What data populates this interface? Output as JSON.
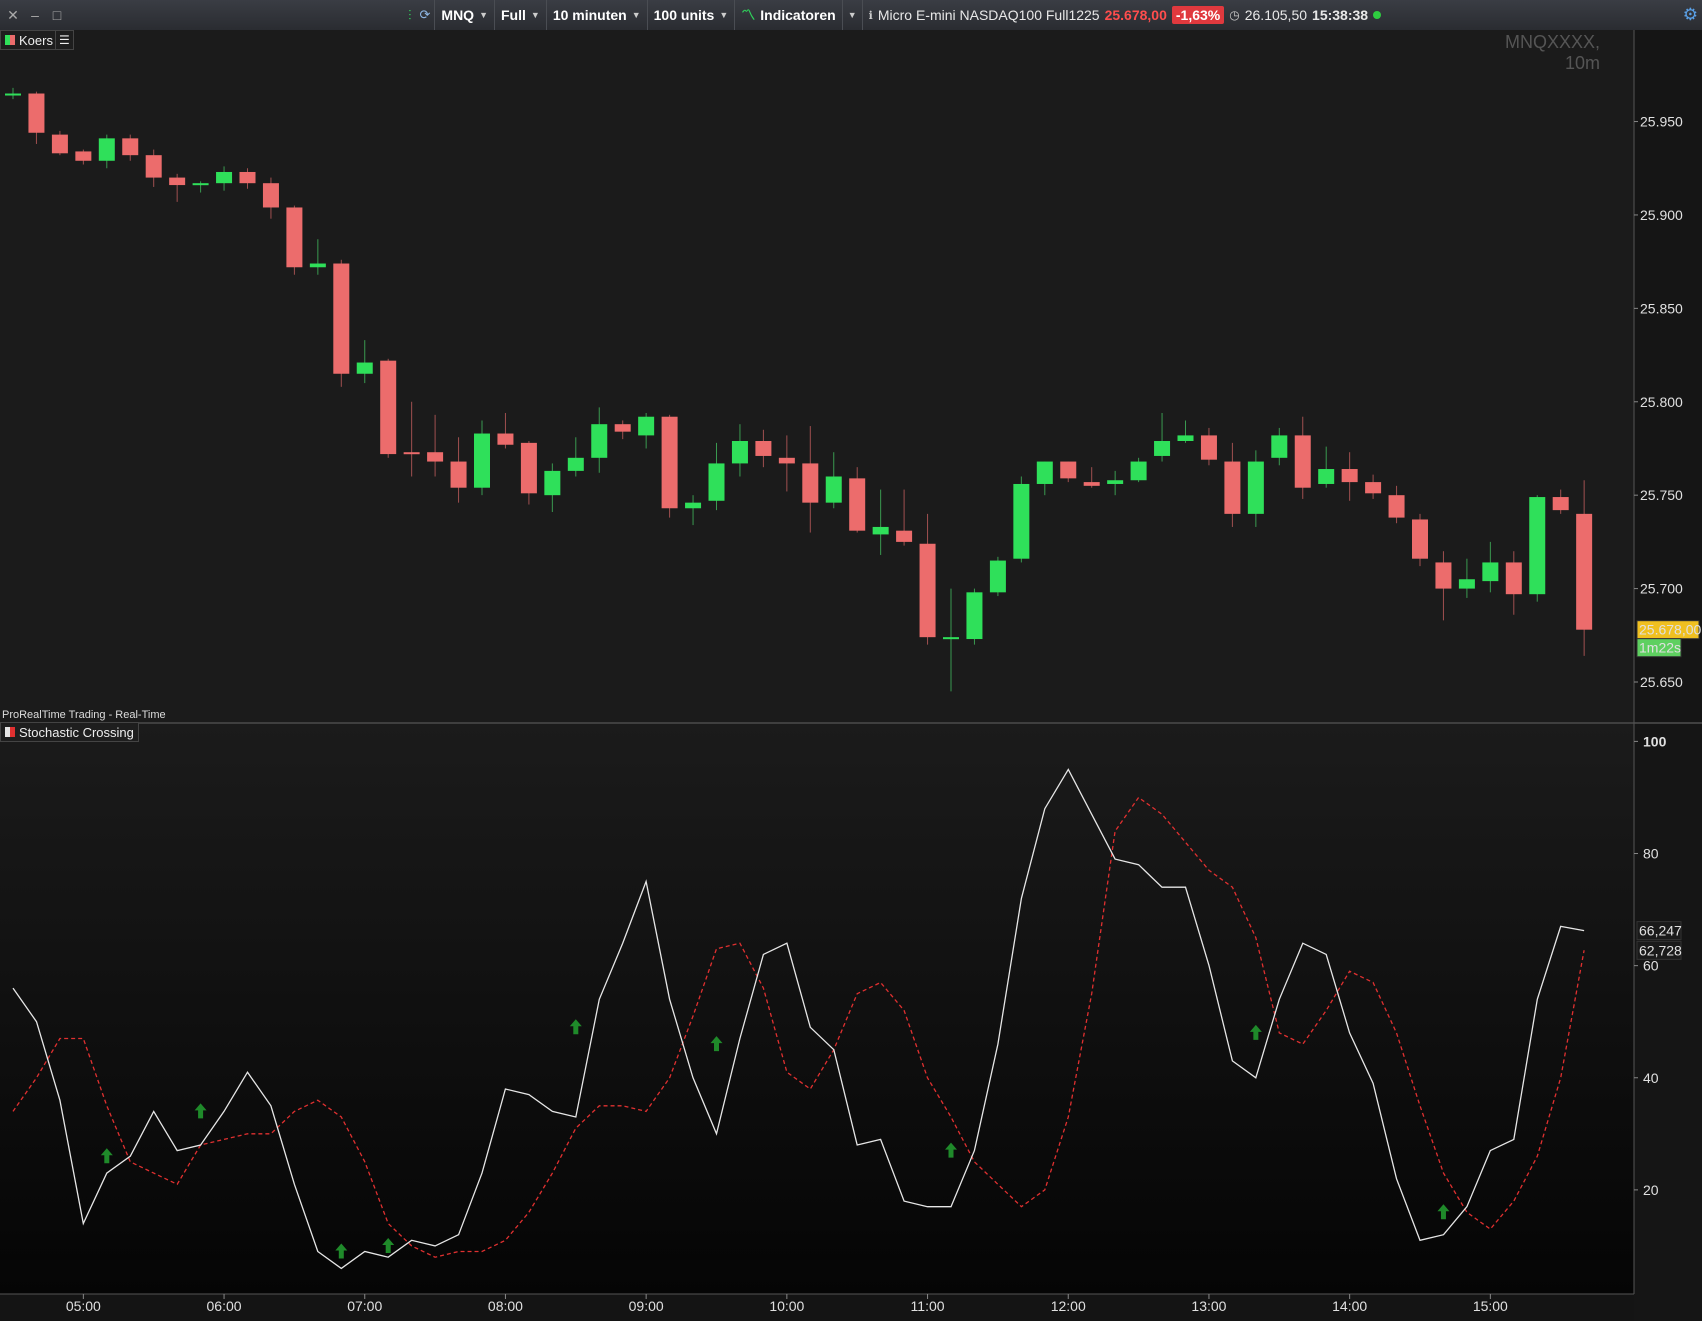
{
  "toolbar": {
    "symbol": "MNQ",
    "mode": "Full",
    "interval": "10 minuten",
    "units": "100 units",
    "indicators": "Indicatoren",
    "instrument": "Micro E-mini NASDAQ100 Full1225",
    "last_price": "25.678,00",
    "change_pct": "-1,63%",
    "prev_value": "26.105,50",
    "clock": "15:38:38"
  },
  "price_pane": {
    "label": "Koers",
    "watermark": "MNQXXXX, 10m",
    "source": "ProRealTime Trading - Real-Time",
    "last_price_tag": "25.678,00",
    "countdown_tag": "1m22s"
  },
  "osc_pane": {
    "label": "Stochastic Crossing",
    "k_value_tag": "66,247",
    "d_value_tag": "62,728"
  },
  "colors": {
    "up": "#2fe05a",
    "down": "#ec6c6c",
    "k_line": "#e6e6e6",
    "d_line": "#e03030",
    "arrow": "#1f8a2a",
    "price_tag": "#f0c020",
    "countdown_tag": "#5ed060"
  },
  "icons": [
    "close-icon",
    "minimize-icon",
    "maximize-icon",
    "bar-chart-icon",
    "sync-icon",
    "chevron-down-icon",
    "indicator-chart-icon",
    "info-icon",
    "clock-icon",
    "settings-gear-icon",
    "list-icon"
  ],
  "chart_data": [
    {
      "type": "candlestick",
      "ylim": [
        25630,
        25985
      ],
      "yticks": [
        "25.650",
        "25.700",
        "25.750",
        "25.800",
        "25.850",
        "25.900",
        "25.950"
      ],
      "ytick_values": [
        25650,
        25700,
        25750,
        25800,
        25850,
        25900,
        25950
      ],
      "xticks": [
        "05:00",
        "06:00",
        "07:00",
        "08:00",
        "09:00",
        "10:00",
        "11:00",
        "12:00",
        "13:00",
        "14:00",
        "15:00"
      ],
      "first_bar_time": "04:30",
      "bar_minutes": 10,
      "candles": [
        {
          "o": 25965,
          "h": 25968,
          "l": 25962,
          "c": 25965
        },
        {
          "o": 25965,
          "h": 25966,
          "l": 25938,
          "c": 25944
        },
        {
          "o": 25943,
          "h": 25945,
          "l": 25932,
          "c": 25933
        },
        {
          "o": 25934,
          "h": 25935,
          "l": 25927,
          "c": 25929
        },
        {
          "o": 25929,
          "h": 25943,
          "l": 25925,
          "c": 25941
        },
        {
          "o": 25941,
          "h": 25943,
          "l": 25929,
          "c": 25932
        },
        {
          "o": 25932,
          "h": 25935,
          "l": 25915,
          "c": 25920
        },
        {
          "o": 25920,
          "h": 25922,
          "l": 25907,
          "c": 25916
        },
        {
          "o": 25916,
          "h": 25918,
          "l": 25912,
          "c": 25917
        },
        {
          "o": 25917,
          "h": 25926,
          "l": 25913,
          "c": 25923
        },
        {
          "o": 25923,
          "h": 25925,
          "l": 25914,
          "c": 25917
        },
        {
          "o": 25917,
          "h": 25920,
          "l": 25898,
          "c": 25904
        },
        {
          "o": 25904,
          "h": 25905,
          "l": 25868,
          "c": 25872
        },
        {
          "o": 25872,
          "h": 25887,
          "l": 25868,
          "c": 25874
        },
        {
          "o": 25874,
          "h": 25876,
          "l": 25808,
          "c": 25815
        },
        {
          "o": 25815,
          "h": 25833,
          "l": 25810,
          "c": 25821
        },
        {
          "o": 25822,
          "h": 25823,
          "l": 25770,
          "c": 25772
        },
        {
          "o": 25773,
          "h": 25800,
          "l": 25760,
          "c": 25772
        },
        {
          "o": 25773,
          "h": 25793,
          "l": 25760,
          "c": 25768
        },
        {
          "o": 25768,
          "h": 25781,
          "l": 25746,
          "c": 25754
        },
        {
          "o": 25754,
          "h": 25790,
          "l": 25750,
          "c": 25783
        },
        {
          "o": 25783,
          "h": 25794,
          "l": 25775,
          "c": 25777
        },
        {
          "o": 25778,
          "h": 25779,
          "l": 25745,
          "c": 25751
        },
        {
          "o": 25750,
          "h": 25767,
          "l": 25741,
          "c": 25763
        },
        {
          "o": 25763,
          "h": 25781,
          "l": 25760,
          "c": 25770
        },
        {
          "o": 25770,
          "h": 25797,
          "l": 25762,
          "c": 25788
        },
        {
          "o": 25788,
          "h": 25790,
          "l": 25780,
          "c": 25784
        },
        {
          "o": 25782,
          "h": 25794,
          "l": 25775,
          "c": 25792
        },
        {
          "o": 25792,
          "h": 25793,
          "l": 25738,
          "c": 25743
        },
        {
          "o": 25743,
          "h": 25750,
          "l": 25734,
          "c": 25746
        },
        {
          "o": 25747,
          "h": 25778,
          "l": 25742,
          "c": 25767
        },
        {
          "o": 25767,
          "h": 25788,
          "l": 25760,
          "c": 25779
        },
        {
          "o": 25779,
          "h": 25785,
          "l": 25765,
          "c": 25771
        },
        {
          "o": 25770,
          "h": 25782,
          "l": 25752,
          "c": 25767
        },
        {
          "o": 25767,
          "h": 25787,
          "l": 25730,
          "c": 25746
        },
        {
          "o": 25746,
          "h": 25773,
          "l": 25743,
          "c": 25760
        },
        {
          "o": 25759,
          "h": 25765,
          "l": 25730,
          "c": 25731
        },
        {
          "o": 25729,
          "h": 25753,
          "l": 25718,
          "c": 25733
        },
        {
          "o": 25731,
          "h": 25753,
          "l": 25723,
          "c": 25725
        },
        {
          "o": 25724,
          "h": 25740,
          "l": 25670,
          "c": 25674
        },
        {
          "o": 25674,
          "h": 25700,
          "l": 25645,
          "c": 25674
        },
        {
          "o": 25673,
          "h": 25700,
          "l": 25670,
          "c": 25698
        },
        {
          "o": 25698,
          "h": 25717,
          "l": 25696,
          "c": 25715
        },
        {
          "o": 25716,
          "h": 25760,
          "l": 25714,
          "c": 25756
        },
        {
          "o": 25756,
          "h": 25768,
          "l": 25750,
          "c": 25768
        },
        {
          "o": 25768,
          "h": 25768,
          "l": 25757,
          "c": 25759
        },
        {
          "o": 25757,
          "h": 25765,
          "l": 25754,
          "c": 25755
        },
        {
          "o": 25756,
          "h": 25763,
          "l": 25750,
          "c": 25758
        },
        {
          "o": 25758,
          "h": 25770,
          "l": 25757,
          "c": 25768
        },
        {
          "o": 25771,
          "h": 25794,
          "l": 25768,
          "c": 25779
        },
        {
          "o": 25779,
          "h": 25790,
          "l": 25778,
          "c": 25782
        },
        {
          "o": 25782,
          "h": 25786,
          "l": 25766,
          "c": 25769
        },
        {
          "o": 25768,
          "h": 25778,
          "l": 25733,
          "c": 25740
        },
        {
          "o": 25740,
          "h": 25774,
          "l": 25733,
          "c": 25768
        },
        {
          "o": 25770,
          "h": 25786,
          "l": 25766,
          "c": 25782
        },
        {
          "o": 25782,
          "h": 25792,
          "l": 25748,
          "c": 25754
        },
        {
          "o": 25756,
          "h": 25776,
          "l": 25754,
          "c": 25764
        },
        {
          "o": 25764,
          "h": 25773,
          "l": 25747,
          "c": 25757
        },
        {
          "o": 25757,
          "h": 25761,
          "l": 25748,
          "c": 25751
        },
        {
          "o": 25750,
          "h": 25755,
          "l": 25735,
          "c": 25738
        },
        {
          "o": 25737,
          "h": 25740,
          "l": 25712,
          "c": 25716
        },
        {
          "o": 25714,
          "h": 25720,
          "l": 25683,
          "c": 25700
        },
        {
          "o": 25700,
          "h": 25716,
          "l": 25695,
          "c": 25705
        },
        {
          "o": 25704,
          "h": 25725,
          "l": 25698,
          "c": 25714
        },
        {
          "o": 25714,
          "h": 25720,
          "l": 25686,
          "c": 25697
        },
        {
          "o": 25697,
          "h": 25750,
          "l": 25693,
          "c": 25749
        },
        {
          "o": 25749,
          "h": 25753,
          "l": 25740,
          "c": 25742
        },
        {
          "o": 25740,
          "h": 25758,
          "l": 25664,
          "c": 25678
        }
      ]
    },
    {
      "type": "line",
      "ylim": [
        0,
        105
      ],
      "yticks": [
        "20",
        "40",
        "60",
        "80",
        "100"
      ],
      "ytick_values": [
        20,
        40,
        60,
        80,
        100
      ],
      "xticks": [
        "05:00",
        "06:00",
        "07:00",
        "08:00",
        "09:00",
        "10:00",
        "11:00",
        "12:00",
        "13:00",
        "14:00",
        "15:00"
      ],
      "series": [
        {
          "values": [
            56,
            50,
            36,
            14,
            23,
            26,
            34,
            27,
            28,
            34,
            41,
            35,
            21,
            9,
            6,
            9,
            8,
            11,
            10,
            12,
            23,
            38,
            37,
            34,
            33,
            54,
            64,
            75,
            54,
            40,
            30,
            47,
            62,
            64,
            49,
            45,
            28,
            29,
            18,
            17,
            17,
            27,
            46,
            72,
            88,
            95,
            87,
            79,
            78,
            74,
            74,
            60,
            43,
            40,
            54,
            64,
            62,
            48,
            39,
            22,
            11,
            12,
            17,
            27,
            29,
            54,
            67,
            66.247
          ]
        },
        {
          "values": [
            34,
            40,
            47,
            47,
            35,
            25,
            23,
            21,
            28,
            29,
            30,
            30,
            34,
            36,
            33,
            25,
            14,
            10,
            8,
            9,
            9,
            11,
            16,
            23,
            31,
            35,
            35,
            34,
            40,
            51,
            63,
            64,
            56,
            41,
            38,
            45,
            55,
            57,
            52,
            40,
            33,
            25,
            21,
            17,
            20,
            33,
            55,
            84,
            90,
            87,
            82,
            77,
            74,
            65,
            48,
            46,
            52,
            59,
            57,
            48,
            35,
            23,
            16,
            13,
            18,
            26,
            40,
            62.728
          ]
        }
      ],
      "cross_arrows": [
        {
          "bar": 4,
          "y": 26
        },
        {
          "bar": 8,
          "y": 34
        },
        {
          "bar": 14,
          "y": 9
        },
        {
          "bar": 16,
          "y": 10
        },
        {
          "bar": 24,
          "y": 49
        },
        {
          "bar": 30,
          "y": 46
        },
        {
          "bar": 40,
          "y": 27
        },
        {
          "bar": 53,
          "y": 48
        },
        {
          "bar": 61,
          "y": 16
        }
      ]
    }
  ]
}
